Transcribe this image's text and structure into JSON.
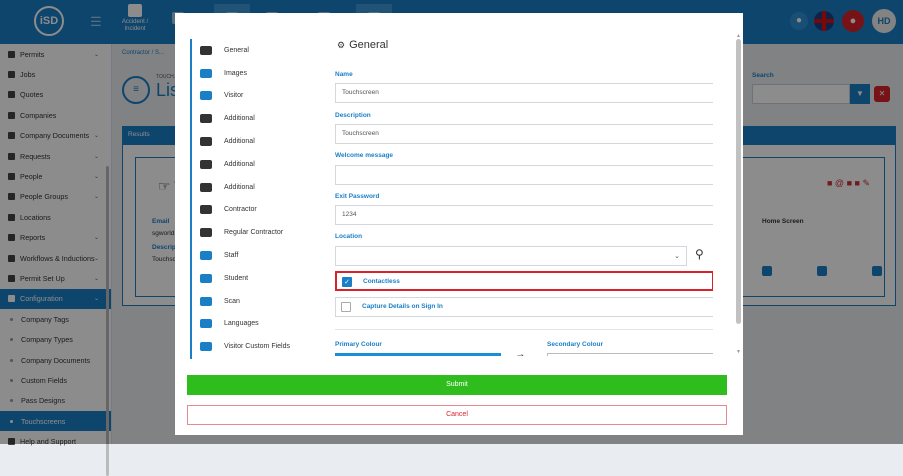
{
  "topbar": {
    "logo": "iSD",
    "accident_label": "Accident / Incident",
    "avatar_initials": "HD"
  },
  "sidebar": {
    "items": [
      {
        "label": "Permits",
        "chevron": true
      },
      {
        "label": "Jobs",
        "chevron": false
      },
      {
        "label": "Quotes",
        "chevron": false
      },
      {
        "label": "Companies",
        "chevron": false
      },
      {
        "label": "Company Documents",
        "chevron": true
      },
      {
        "label": "Requests",
        "chevron": true
      },
      {
        "label": "People",
        "chevron": true
      },
      {
        "label": "People Groups",
        "chevron": true
      },
      {
        "label": "Locations",
        "chevron": false
      },
      {
        "label": "Reports",
        "chevron": true
      },
      {
        "label": "Workflows & Inductions",
        "chevron": true
      },
      {
        "label": "Permit Set Up",
        "chevron": true
      },
      {
        "label": "Configuration",
        "chevron": true,
        "active": true
      }
    ],
    "subitems": [
      {
        "label": "Company Tags"
      },
      {
        "label": "Company Types"
      },
      {
        "label": "Company Documents"
      },
      {
        "label": "Custom Fields"
      },
      {
        "label": "Pass Designs"
      },
      {
        "label": "Touchscreens",
        "active": true
      }
    ],
    "footer": "Help and Support"
  },
  "main": {
    "breadcrumb": "Contractor / S...",
    "page_title_small": "TOUCH...",
    "page_title": "Lis",
    "search_label": "Search",
    "results_label": "Results",
    "card_title": "To",
    "email_label": "Email",
    "email_value": "sgworld...",
    "description_label": "Descripti...",
    "description_value": "Touchsc...",
    "home_screen_label": "Home Screen"
  },
  "modal": {
    "tabs": [
      {
        "label": "General",
        "icon": "cogs-icon",
        "dark": true
      },
      {
        "label": "Images",
        "icon": "image-icon"
      },
      {
        "label": "Visitor",
        "icon": "walking-icon"
      },
      {
        "label": "Additional",
        "icon": "walking-icon",
        "dark": true
      },
      {
        "label": "Additional",
        "icon": "walking-icon",
        "dark": true
      },
      {
        "label": "Additional",
        "icon": "walking-icon",
        "dark": true
      },
      {
        "label": "Additional",
        "icon": "walking-icon",
        "dark": true
      },
      {
        "label": "Contractor",
        "icon": "hard-hat-icon",
        "dark": true
      },
      {
        "label": "Regular Contractor",
        "icon": "user-cog-icon",
        "dark": true
      },
      {
        "label": "Staff",
        "icon": "user-icon"
      },
      {
        "label": "Student",
        "icon": "graduation-icon"
      },
      {
        "label": "Scan",
        "icon": "qrcode-icon"
      },
      {
        "label": "Languages",
        "icon": "flag-icon"
      },
      {
        "label": "Visitor Custom Fields",
        "icon": "list-icon"
      }
    ],
    "section_title": "General",
    "fields": {
      "name_label": "Name",
      "name_value": "Touchscreen",
      "description_label": "Description",
      "description_value": "Touchscreen",
      "welcome_label": "Welcome message",
      "welcome_value": "",
      "exit_password_label": "Exit Password",
      "exit_password_value": "1234",
      "location_label": "Location"
    },
    "checkboxes": {
      "contactless_label": "Contactless",
      "contactless_checked": true,
      "capture_label": "Capture Details on Sign In",
      "capture_checked": false
    },
    "colours": {
      "primary_label": "Primary Colour",
      "secondary_label": "Secondary Colour",
      "primary_hex": "#1b8fd6"
    },
    "submit_label": "Submit",
    "cancel_label": "Cancel"
  }
}
